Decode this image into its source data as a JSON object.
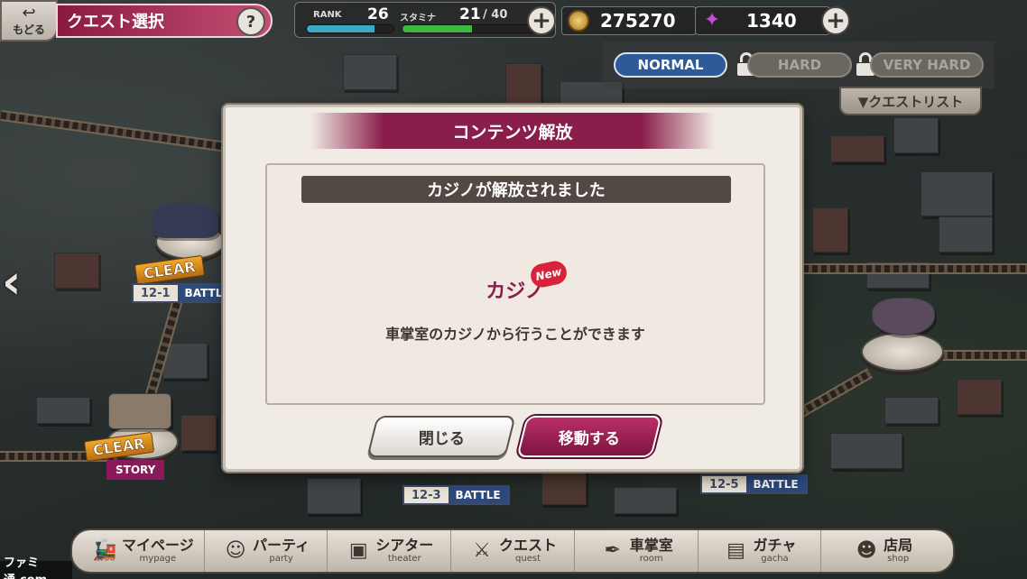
{
  "header": {
    "back_label": "もどる",
    "title": "クエスト選択",
    "help_label": "?"
  },
  "stats": {
    "rank_label": "RANK",
    "rank_value": "26",
    "rank_progress": 0.78,
    "stamina_label": "スタミナ",
    "stamina_current": "21",
    "stamina_max": "/ 40",
    "stamina_progress": 0.525,
    "coins": "275270",
    "gems": "1340"
  },
  "difficulty": {
    "normal": "NORMAL",
    "hard": "HARD",
    "very_hard": "VERY HARD",
    "quest_list": "▼クエストリスト"
  },
  "nodes": [
    {
      "num": "12-1",
      "type": "BATTLE",
      "badge": "CLEAR"
    },
    {
      "num": "",
      "type": "STORY",
      "badge": "CLEAR"
    },
    {
      "num": "12-3",
      "type": "BATTLE"
    },
    {
      "num": "12-5",
      "type": "BATTLE"
    }
  ],
  "modal": {
    "title": "コンテンツ解放",
    "subtitle": "カジノが解放されました",
    "feature_name": "カジノ",
    "new_badge": "New",
    "description": "車掌室のカジノから行うことができます",
    "close_label": "閉じる",
    "move_label": "移動する"
  },
  "menu": [
    {
      "jp": "マイページ",
      "en": "mypage",
      "icon": "train-icon"
    },
    {
      "jp": "パーティ",
      "en": "party",
      "icon": "character-icon"
    },
    {
      "jp": "シアター",
      "en": "theater",
      "icon": "projector-icon"
    },
    {
      "jp": "クエスト",
      "en": "quest",
      "icon": "swords-icon"
    },
    {
      "jp": "車掌室",
      "en": "room",
      "icon": "pen-icon"
    },
    {
      "jp": "ガチャ",
      "en": "gacha",
      "icon": "ticket-icon"
    },
    {
      "jp": "店局",
      "en": "shop",
      "icon": "shopkeeper-icon"
    }
  ],
  "watermark": "ファミ通.com",
  "colors": {
    "accent": "#8a1e4a",
    "rank_bar": "#3ba9c4",
    "stamina_bar": "#3fb83f",
    "normal_active": "#2e5a9a"
  }
}
